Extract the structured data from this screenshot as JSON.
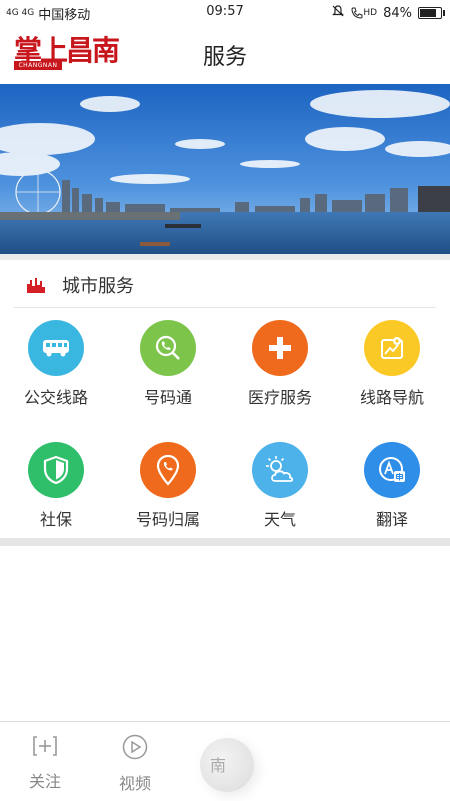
{
  "status_bar": {
    "network": "4G 4G",
    "carrier": "中国移动",
    "time": "09:57",
    "hd": "HD",
    "battery": "84%",
    "battery_level": 0.84
  },
  "header": {
    "logo_text": "掌上昌南",
    "logo_sub": "CHANGNAN",
    "title": "服务"
  },
  "section": {
    "title": "城市服务"
  },
  "services": [
    {
      "label": "公交线路",
      "icon": "bus-icon",
      "color": "#3ab7e0"
    },
    {
      "label": "号码通",
      "icon": "phone-search-icon",
      "color": "#7dc54a"
    },
    {
      "label": "医疗服务",
      "icon": "medical-cross-icon",
      "color": "#f06a1d"
    },
    {
      "label": "线路导航",
      "icon": "map-navigation-icon",
      "color": "#fbc925"
    },
    {
      "label": "社保",
      "icon": "shield-icon",
      "color": "#2fbf6a"
    },
    {
      "label": "号码归属",
      "icon": "phone-location-icon",
      "color": "#f06a1d"
    },
    {
      "label": "天气",
      "icon": "weather-icon",
      "color": "#4db1ea"
    },
    {
      "label": "翻译",
      "icon": "translate-icon",
      "color": "#2f8ee8"
    }
  ],
  "tabbar": {
    "items": [
      {
        "label": "关注",
        "icon": "add-follow-icon"
      },
      {
        "label": "视频",
        "icon": "play-icon"
      }
    ],
    "floating_label": "南"
  }
}
